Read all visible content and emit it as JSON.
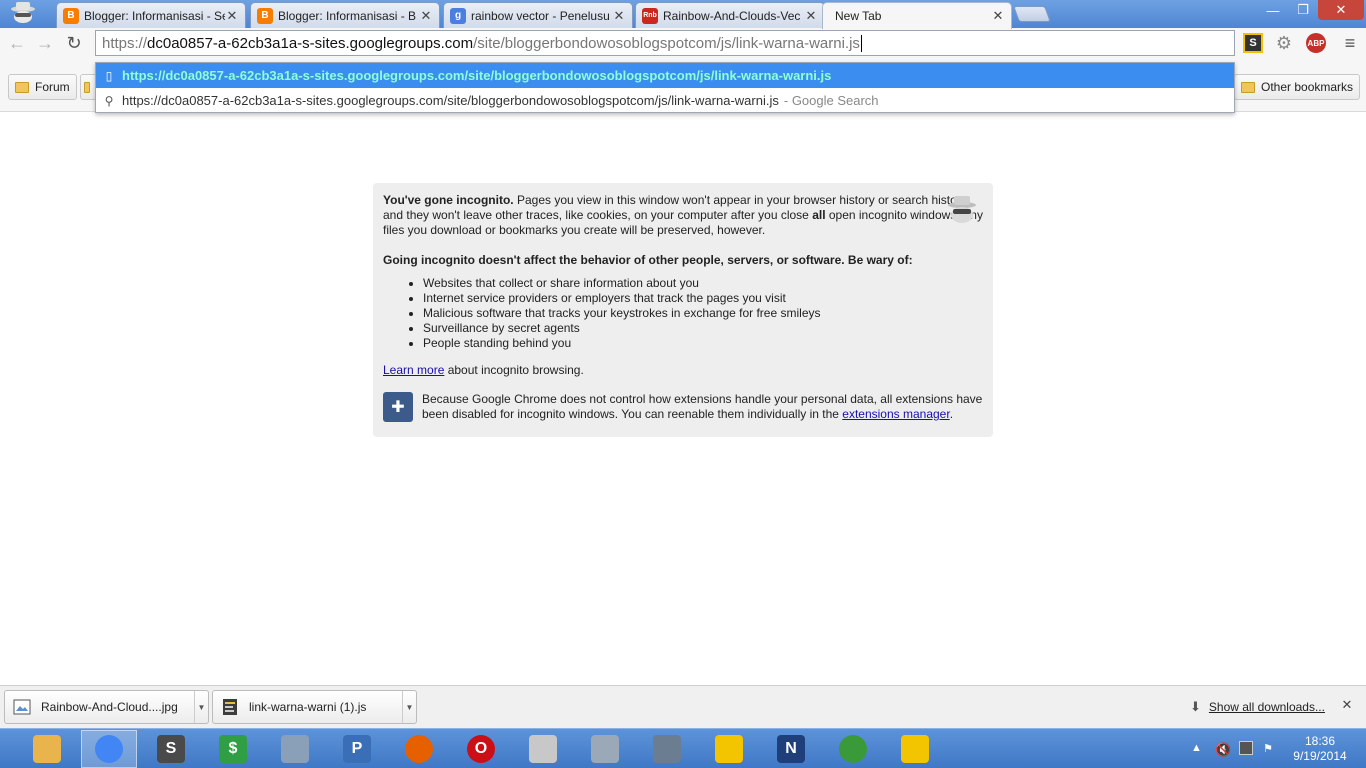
{
  "tabs": [
    {
      "title": "Blogger: Informanisasi - Se",
      "favicon": "blogger-icon"
    },
    {
      "title": "Blogger: Informanisasi - B",
      "favicon": "blogger-icon"
    },
    {
      "title": "rainbow vector - Penelusu",
      "favicon": "google-icon"
    },
    {
      "title": "Rainbow-And-Clouds-Vec",
      "favicon": "rainbow-image-icon"
    },
    {
      "title": "New Tab",
      "favicon": ""
    }
  ],
  "tab_close_glyph": "✕",
  "window": {
    "min": "—",
    "max": "❐",
    "close": "✕"
  },
  "toolbar": {
    "back": "←",
    "forward": "→",
    "reload": "↻",
    "menu": "≡",
    "ext_s": "S",
    "ext_gear": "⚙",
    "ext_abp": "ABP"
  },
  "omnibox": {
    "scheme": "https://",
    "host": "dc0a0857-a-62cb3a1a-s-sites.googlegroups.com",
    "path": "/site/bloggerbondowosoblogspotcom/js/link-warna-warni.js"
  },
  "suggestions": [
    {
      "text": "https://dc0a0857-a-62cb3a1a-s-sites.googlegroups.com/site/bloggerbondowosoblogspotcom/js/link-warna-warni.js",
      "suffix": "",
      "icon": "page-icon"
    },
    {
      "text": "https://dc0a0857-a-62cb3a1a-s-sites.googlegroups.com/site/bloggerbondowosoblogspotcom/js/link-warna-warni.js",
      "suffix": "- Google Search",
      "icon": "search-icon"
    }
  ],
  "bookmarks": {
    "forum": "Forum",
    "other": "Other bookmarks"
  },
  "incognito": {
    "p1_bold": "You've gone incognito.",
    "p1_a": " Pages you view in this window won't appear in your browser history or search history, and they won't leave other traces, like cookies, on your computer after you close ",
    "p1_all": "all",
    "p1_b": " open incognito windows. Any files you download or bookmarks you create will be preserved, however.",
    "p2": "Going incognito doesn't affect the behavior of other people, servers, or software. Be wary of:",
    "list": [
      "Websites that collect or share information about you",
      "Internet service providers or employers that track the pages you visit",
      "Malicious software that tracks your keystrokes in exchange for free smileys",
      "Surveillance by secret agents",
      "People standing behind you"
    ],
    "learn_more": "Learn more",
    "learn_more_rest": " about incognito browsing.",
    "ext_text": "Because Google Chrome does not control how extensions handle your personal data, all extensions have been disabled for incognito windows. You can reenable them individually in the ",
    "ext_link": "extensions manager",
    "ext_end": "."
  },
  "downloads": {
    "items": [
      {
        "name": "Rainbow-And-Cloud....jpg",
        "icon": "image-file-icon"
      },
      {
        "name": "link-warna-warni (1).js",
        "icon": "script-file-icon"
      }
    ],
    "dropdown_glyph": "▼",
    "show_all": "Show all downloads...",
    "close": "✕"
  },
  "taskbar": {
    "apps": [
      {
        "name": "file-explorer",
        "glyph": "",
        "color": "#e9b44c"
      },
      {
        "name": "chrome",
        "glyph": "",
        "color": "#4285f4"
      },
      {
        "name": "sublime-text",
        "glyph": "S",
        "color": "#4a4a4a"
      },
      {
        "name": "money-app",
        "glyph": "$",
        "color": "#2f9e44"
      },
      {
        "name": "monitor-app",
        "glyph": "",
        "color": "#8aa0b8"
      },
      {
        "name": "net-app",
        "glyph": "P",
        "color": "#3a6fb8"
      },
      {
        "name": "firefox",
        "glyph": "",
        "color": "#e66000"
      },
      {
        "name": "opera",
        "glyph": "O",
        "color": "#cc0f16"
      },
      {
        "name": "device-app",
        "glyph": "",
        "color": "#c8c8c8"
      },
      {
        "name": "tools-app",
        "glyph": "",
        "color": "#9aa8b8"
      },
      {
        "name": "loader-app",
        "glyph": "",
        "color": "#6b7d90"
      },
      {
        "name": "paint-app",
        "glyph": "",
        "color": "#f2c500"
      },
      {
        "name": "notepad-n",
        "glyph": "N",
        "color": "#1f3f7a"
      },
      {
        "name": "idm-app",
        "glyph": "",
        "color": "#3a9a3a"
      },
      {
        "name": "paint-app-2",
        "glyph": "",
        "color": "#f2c500"
      }
    ],
    "tray": {
      "chevron": "▲",
      "time": "18:36",
      "date": "9/19/2014"
    }
  }
}
